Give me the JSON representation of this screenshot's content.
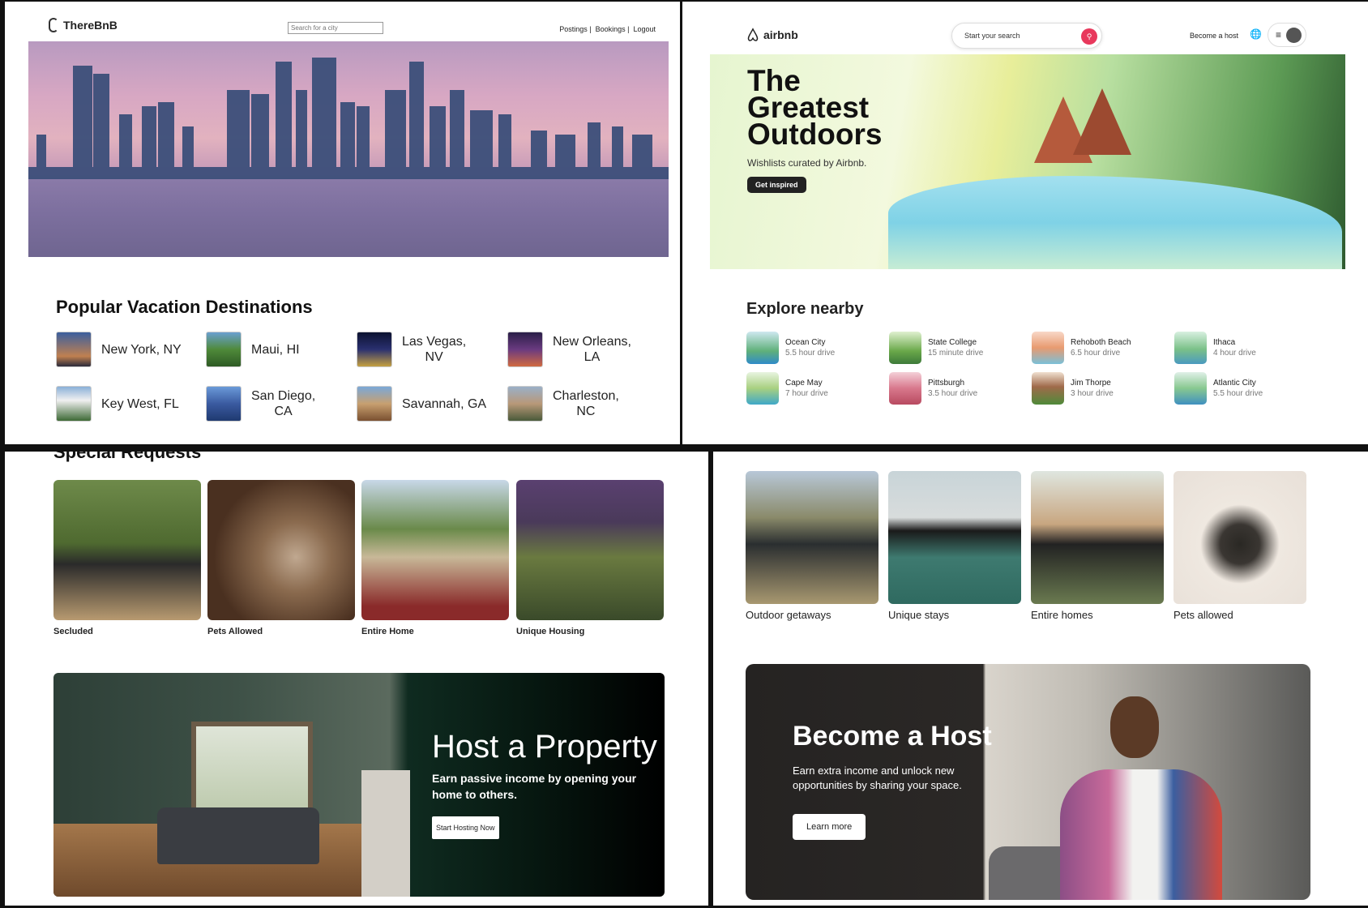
{
  "therebnb": {
    "brand": "ThereBnB",
    "search_placeholder": "Search for a city",
    "nav": [
      "Postings |",
      "Bookings |",
      "Logout"
    ],
    "popular_title": "Popular Vacation Destinations",
    "destinations": [
      {
        "name": "New York, NY"
      },
      {
        "name": "Maui, HI"
      },
      {
        "name": "Las Vegas,\nNV"
      },
      {
        "name": "New Orleans,\nLA"
      },
      {
        "name": "Key West, FL"
      },
      {
        "name": "San Diego,\nCA"
      },
      {
        "name": "Savannah, GA"
      },
      {
        "name": "Charleston,\nNC"
      }
    ],
    "special_title": "Special Requests",
    "requests": [
      "Secluded",
      "Pets Allowed",
      "Entire Home",
      "Unique Housing"
    ],
    "host_banner": {
      "title": "Host a Property",
      "text": "Earn passive income by opening your home to others.",
      "cta": "Start Hosting Now"
    }
  },
  "airbnb": {
    "brand": "airbnb",
    "search_text": "Start your search",
    "become_host": "Become a host",
    "hero": {
      "title": "The Greatest Outdoors",
      "subtitle": "Wishlists curated by Airbnb.",
      "cta": "Get inspired"
    },
    "explore_title": "Explore nearby",
    "nearby": [
      {
        "city": "Ocean City",
        "drive": "5.5 hour drive"
      },
      {
        "city": "State College",
        "drive": "15 minute drive"
      },
      {
        "city": "Rehoboth Beach",
        "drive": "6.5 hour drive"
      },
      {
        "city": "Ithaca",
        "drive": "4 hour drive"
      },
      {
        "city": "Cape May",
        "drive": "7 hour drive"
      },
      {
        "city": "Pittsburgh",
        "drive": "3.5 hour drive"
      },
      {
        "city": "Jim Thorpe",
        "drive": "3 hour drive"
      },
      {
        "city": "Atlantic City",
        "drive": "5.5 hour drive"
      }
    ],
    "categories": [
      "Outdoor getaways",
      "Unique stays",
      "Entire homes",
      "Pets allowed"
    ],
    "host_banner": {
      "title": "Become a Host",
      "text": "Earn extra income and unlock new opportunities by sharing your space.",
      "cta": "Learn more"
    }
  },
  "colors": {
    "airbnb_accent": "#e8385c",
    "banner_dark": "#222222"
  }
}
